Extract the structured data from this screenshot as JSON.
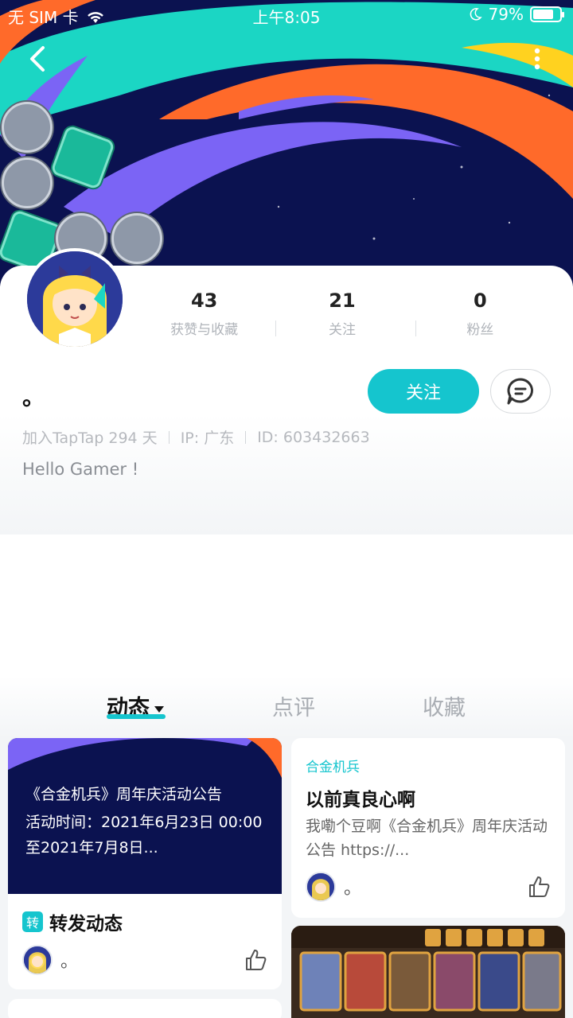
{
  "status_bar": {
    "carrier": "无 SIM 卡",
    "time": "上午8:05",
    "battery": "79%",
    "battery_level": 0.79
  },
  "icons": {
    "back": "chevron-left-icon",
    "more": "more-vertical-icon",
    "message": "chat-bubble-icon",
    "like": "thumbs-up-icon",
    "wifi": "wifi-icon",
    "moon": "moon-icon"
  },
  "profile": {
    "stats": [
      {
        "value": "43",
        "label": "获赞与收藏"
      },
      {
        "value": "21",
        "label": "关注"
      },
      {
        "value": "0",
        "label": "粉丝"
      }
    ],
    "username": "。",
    "follow_label": "关注",
    "joined": "加入TapTap 294 天",
    "ip": "IP: 广东",
    "id": "ID: 603432663",
    "bio": "Hello Gamer !"
  },
  "tabs": [
    {
      "label": "动态",
      "active": true
    },
    {
      "label": "点评",
      "active": false
    },
    {
      "label": "收藏",
      "active": false
    }
  ],
  "feed": {
    "left_card": {
      "cover_title": "《合金机兵》周年庆活动公告",
      "cover_text": "活动时间：2021年6月23日 00:00 至2021年7月8日...",
      "repost_tag": "转",
      "repost_label": "转发动态",
      "author": "。"
    },
    "right_card": {
      "game": "合金机兵",
      "title": "以前真良心啊",
      "excerpt": "我嘞个豆啊《合金机兵》周年庆活动公告  https://...",
      "author": "。"
    }
  },
  "colors": {
    "accent": "#15c5ce",
    "banner_bg": "#0b1250"
  }
}
